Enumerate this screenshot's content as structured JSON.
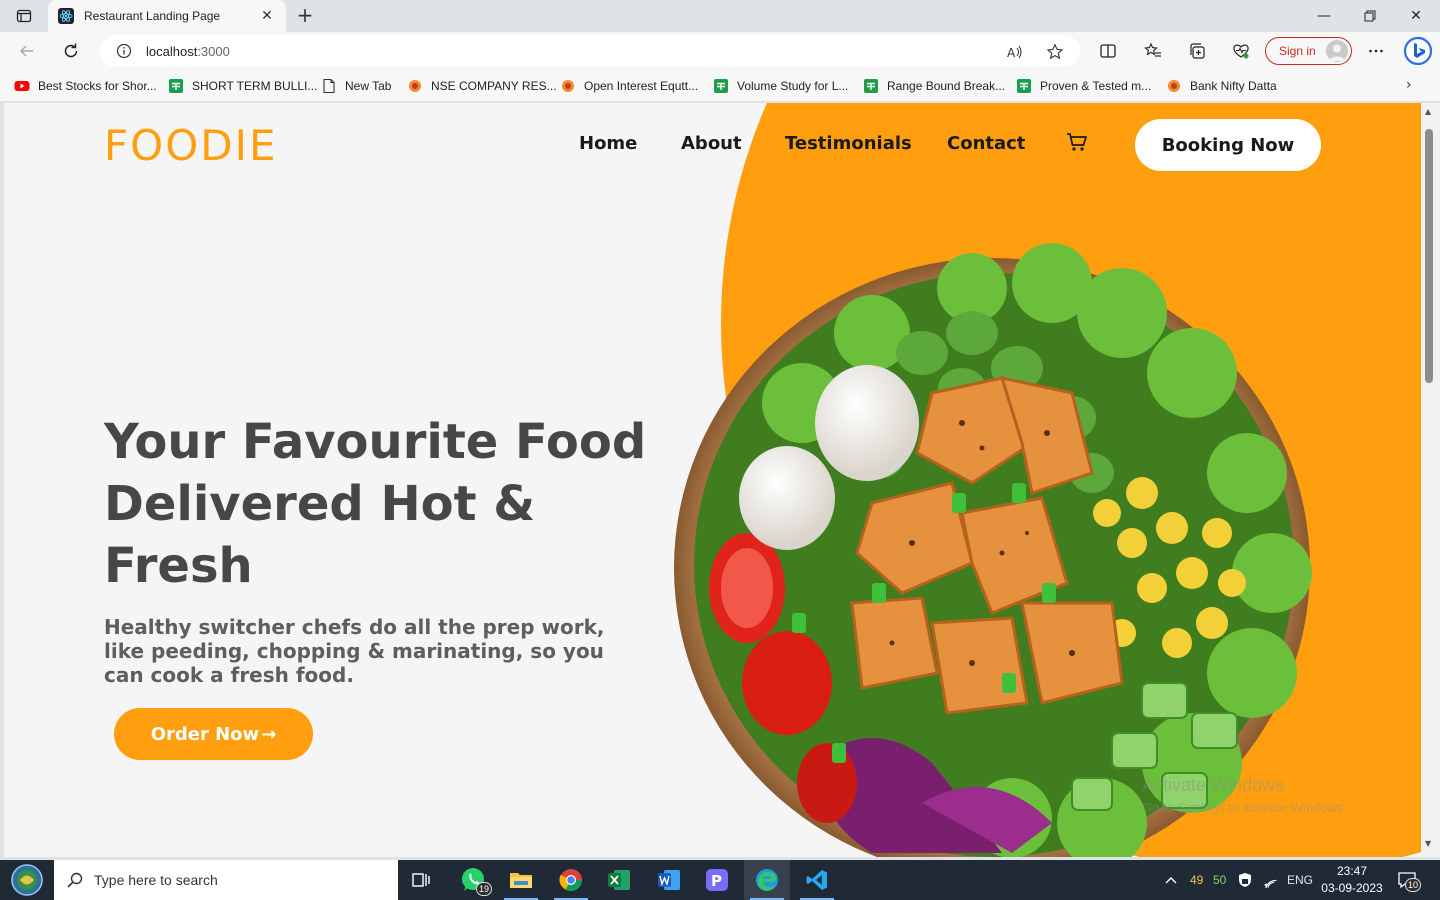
{
  "browser": {
    "tab_title": "Restaurant Landing Page",
    "url_host": "localhost",
    "url_port": ":3000",
    "signin_label": "Sign in"
  },
  "bookmarks": [
    {
      "label": "Best Stocks for Shor...",
      "icon": "youtube-icon"
    },
    {
      "label": "SHORT TERM BULLI...",
      "icon": "sheets-icon"
    },
    {
      "label": "New Tab",
      "icon": "page-icon"
    },
    {
      "label": "NSE COMPANY RES...",
      "icon": "site-icon"
    },
    {
      "label": "Open Interest Equtt...",
      "icon": "site-icon"
    },
    {
      "label": "Volume Study for L...",
      "icon": "sheets-icon"
    },
    {
      "label": "Range Bound Break...",
      "icon": "sheets-icon"
    },
    {
      "label": "Proven & Tested m...",
      "icon": "sheets-icon"
    },
    {
      "label": "Bank Nifty Datta",
      "icon": "site-icon"
    }
  ],
  "site": {
    "logo": "FOODIE",
    "nav": [
      "Home",
      "About",
      "Testimonials",
      "Contact"
    ],
    "booking_label": "Booking Now",
    "hero_title": "Your Favourite Food Delivered Hot & Fresh",
    "hero_subtitle": "Healthy switcher chefs do all the prep work, like peeding, chopping & marinating, so you can cook a fresh food.",
    "order_label": "Order Now",
    "order_arrow": "→",
    "accent_color": "#ff9f0f"
  },
  "watermark": {
    "line1": "Activate Windows",
    "line2": "Go to Settings to activate Windows."
  },
  "taskbar": {
    "search_placeholder": "Type here to search",
    "whatsapp_badge": "19",
    "tray_num1": "49",
    "tray_num2": "50",
    "language": "ENG",
    "time": "23:47",
    "date": "03-09-2023",
    "notification_count": "10"
  }
}
